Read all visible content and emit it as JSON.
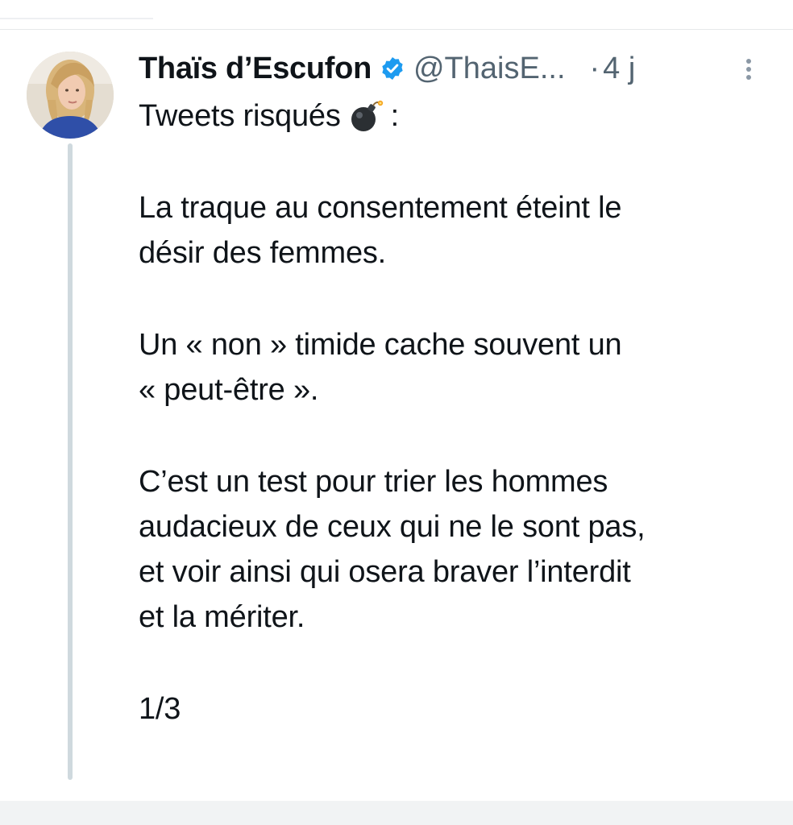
{
  "tweet": {
    "author_name": "Thaïs d’Escufon",
    "handle": "@ThaisE...",
    "separator": "·",
    "time": "4 j",
    "verified_color": "#1d9bf0",
    "lead_text": "Tweets risqués",
    "lead_suffix": ":",
    "lead_emoji": "bomb-icon",
    "paragraphs": [
      "La traque au consentement éteint le\ndésir des femmes.",
      "Un « non » timide cache souvent un\n« peut-être ».",
      "C’est un test pour trier les hommes\naudacieux de ceux qui ne le sont pas,\net voir ainsi qui osera braver l’interdit\net la mériter.",
      "1/3"
    ]
  }
}
